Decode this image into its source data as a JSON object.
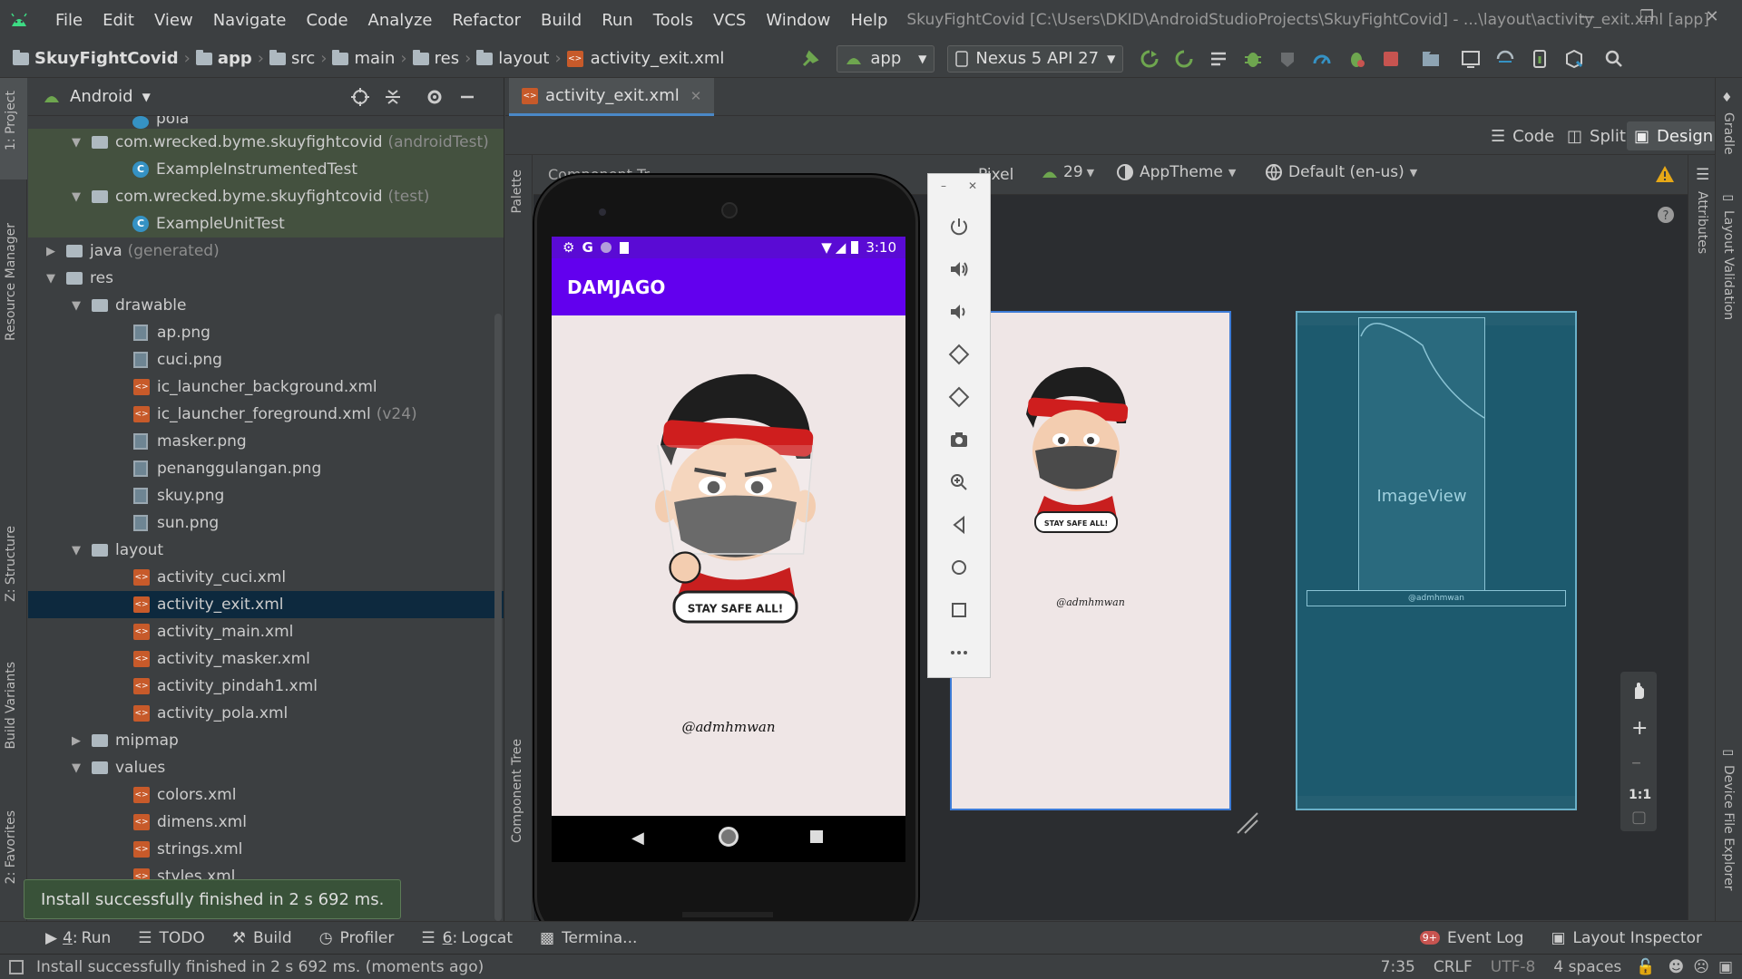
{
  "menubar": {
    "items": [
      "File",
      "Edit",
      "View",
      "Navigate",
      "Code",
      "Analyze",
      "Refactor",
      "Build",
      "Run",
      "Tools",
      "VCS",
      "Window",
      "Help"
    ],
    "title": "SkuyFightCovid [C:\\Users\\DKID\\AndroidStudioProjects\\SkuyFightCovid] - ...\\layout\\activity_exit.xml [app]"
  },
  "breadcrumb": [
    "SkuyFightCovid",
    "app",
    "src",
    "main",
    "res",
    "layout",
    "activity_exit.xml"
  ],
  "toolbar": {
    "run_config": "app",
    "device": "Nexus 5 API 27"
  },
  "project": {
    "view_mode": "Android",
    "rows": [
      {
        "label": "pola",
        "suffix": ""
      },
      {
        "label": "com.wrecked.byme.skuyfightcovid",
        "suffix": "(androidTest)"
      },
      {
        "label": "ExampleInstrumentedTest",
        "suffix": ""
      },
      {
        "label": "com.wrecked.byme.skuyfightcovid",
        "suffix": "(test)"
      },
      {
        "label": "ExampleUnitTest",
        "suffix": ""
      },
      {
        "label": "java",
        "suffix": "(generated)"
      },
      {
        "label": "res",
        "suffix": ""
      },
      {
        "label": "drawable",
        "suffix": ""
      },
      {
        "label": "ap.png",
        "suffix": ""
      },
      {
        "label": "cuci.png",
        "suffix": ""
      },
      {
        "label": "ic_launcher_background.xml",
        "suffix": ""
      },
      {
        "label": "ic_launcher_foreground.xml",
        "suffix": "(v24)"
      },
      {
        "label": "masker.png",
        "suffix": ""
      },
      {
        "label": "penanggulangan.png",
        "suffix": ""
      },
      {
        "label": "skuy.png",
        "suffix": ""
      },
      {
        "label": "sun.png",
        "suffix": ""
      },
      {
        "label": "layout",
        "suffix": ""
      },
      {
        "label": "activity_cuci.xml",
        "suffix": ""
      },
      {
        "label": "activity_exit.xml",
        "suffix": ""
      },
      {
        "label": "activity_main.xml",
        "suffix": ""
      },
      {
        "label": "activity_masker.xml",
        "suffix": ""
      },
      {
        "label": "activity_pindah1.xml",
        "suffix": ""
      },
      {
        "label": "activity_pola.xml",
        "suffix": ""
      },
      {
        "label": "mipmap",
        "suffix": ""
      },
      {
        "label": "values",
        "suffix": ""
      },
      {
        "label": "colors.xml",
        "suffix": ""
      },
      {
        "label": "dimens.xml",
        "suffix": ""
      },
      {
        "label": "strings.xml",
        "suffix": ""
      },
      {
        "label": "styles.xml",
        "suffix": ""
      }
    ]
  },
  "editor": {
    "tab": "activity_exit.xml",
    "modes": [
      "Code",
      "Split",
      "Design"
    ],
    "component_tree_label": "Component Tr...",
    "device_label": "Pixel",
    "api": "29",
    "theme": "AppTheme",
    "locale": "Default (en-us)"
  },
  "stripes": {
    "left": [
      "1: Project",
      "Resource Manager",
      "Z: Structure",
      "Build Variants",
      "2: Favorites"
    ],
    "right": [
      "Gradle",
      "Layout Validation",
      "Device File Explorer"
    ],
    "palette": "Palette",
    "component_tree": "Component Tree",
    "attributes": "Attributes"
  },
  "phone": {
    "time": "3:10",
    "app_title": "DAMJAGO",
    "credit": "@admhmwan",
    "sticker_text": "STAY SAFE ALL!"
  },
  "blueprint": {
    "imageview_label": "ImageView",
    "text_label": "@admhmwan"
  },
  "zoom_controls": {
    "one_to_one": "1:1"
  },
  "toast": "Install successfully finished in 2 s 692 ms.",
  "toolwindows": [
    {
      "num": "4",
      "label": "Run"
    },
    {
      "num": "",
      "label": "TODO"
    },
    {
      "num": "",
      "label": "Build"
    },
    {
      "num": "",
      "label": "Profiler"
    },
    {
      "num": "6",
      "label": "Logcat"
    },
    {
      "num": "",
      "label": "Termina..."
    }
  ],
  "event_log": {
    "badge": "9+",
    "label": "Event Log"
  },
  "layout_inspector": "Layout Inspector",
  "status": {
    "message": "Install successfully finished in 2 s 692 ms. (moments ago)",
    "position": "7:35",
    "line_sep": "CRLF",
    "encoding": "UTF-8",
    "indent": "4 spaces"
  },
  "colors": {
    "ide_bg": "#3c3f41",
    "accent": "#4a88c7",
    "app_primary": "#6200ee",
    "status_bar": "#5a0bd4",
    "screen_bg": "#efe6e6",
    "blueprint": "#1d5a6e"
  }
}
